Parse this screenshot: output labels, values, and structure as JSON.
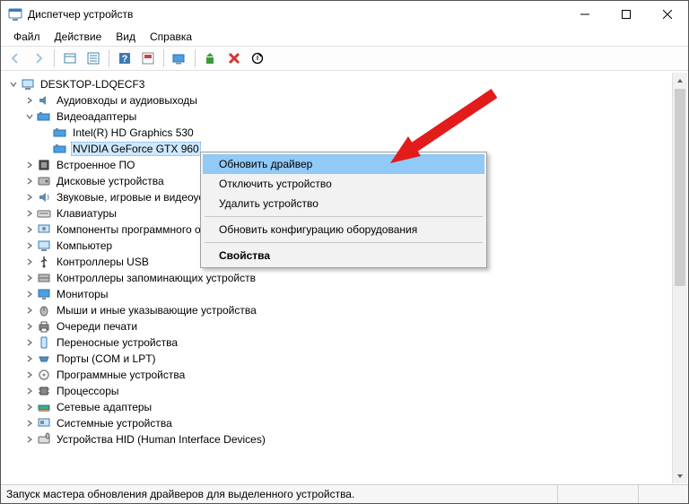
{
  "window": {
    "title": "Диспетчер устройств"
  },
  "menubar": {
    "file": "Файл",
    "action": "Действие",
    "view": "Вид",
    "help": "Справка"
  },
  "tree": {
    "root": "DESKTOP-LDQECF3",
    "cats": {
      "audio": "Аудиовходы и аудиовыходы",
      "display": "Видеоадаптеры",
      "display_children": {
        "intel": "Intel(R) HD Graphics 530",
        "nvidia": "NVIDIA GeForce GTX 960"
      },
      "firmware": "Встроенное ПО",
      "disk": "Дисковые устройства",
      "sound": "Звуковые, игровые и видеоустройства",
      "keyboard": "Клавиатуры",
      "software": "Компоненты программного обеспечения",
      "computer": "Компьютер",
      "usb": "Контроллеры USB",
      "storage": "Контроллеры запоминающих устройств",
      "monitor": "Мониторы",
      "mouse": "Мыши и иные указывающие устройства",
      "printq": "Очереди печати",
      "portable": "Переносные устройства",
      "ports": "Порты (COM и LPT)",
      "softdev": "Программные устройства",
      "cpu": "Процессоры",
      "network": "Сетевые адаптеры",
      "system": "Системные устройства",
      "hid": "Устройства HID (Human Interface Devices)"
    }
  },
  "ctx": {
    "update": "Обновить драйвер",
    "disable": "Отключить устройство",
    "uninstall": "Удалить устройство",
    "scan": "Обновить конфигурацию оборудования",
    "properties": "Свойства"
  },
  "status": {
    "text": "Запуск мастера обновления драйверов для выделенного устройства."
  }
}
